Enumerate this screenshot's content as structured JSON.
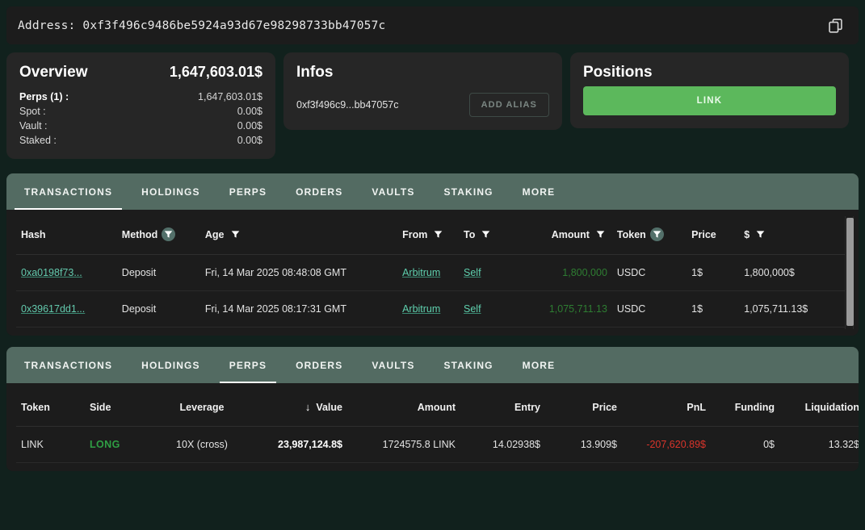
{
  "address_bar": {
    "label": "Address:",
    "value": "0xf3f496c9486be5924a93d67e98298733bb47057c",
    "copy_icon": "copy-icon"
  },
  "overview": {
    "title": "Overview",
    "total": "1,647,603.01$",
    "rows": [
      {
        "label": "Perps (1) :",
        "value": "1,647,603.01$"
      },
      {
        "label": "Spot :",
        "value": "0.00$"
      },
      {
        "label": "Vault :",
        "value": "0.00$"
      },
      {
        "label": "Staked :",
        "value": "0.00$"
      }
    ]
  },
  "infos": {
    "title": "Infos",
    "address_short": "0xf3f496c9...bb47057c",
    "add_alias_label": "ADD ALIAS"
  },
  "positions": {
    "title": "Positions",
    "link_label": "LINK"
  },
  "tabs": [
    "TRANSACTIONS",
    "HOLDINGS",
    "PERPS",
    "ORDERS",
    "VAULTS",
    "STAKING",
    "MORE"
  ],
  "transactions_panel": {
    "active_tab": "TRANSACTIONS",
    "columns": [
      {
        "label": "Hash",
        "filter": "none"
      },
      {
        "label": "Method",
        "filter": "active"
      },
      {
        "label": "Age",
        "filter": "idle"
      },
      {
        "label": "From",
        "filter": "idle"
      },
      {
        "label": "To",
        "filter": "idle"
      },
      {
        "label": "Amount",
        "filter": "idle"
      },
      {
        "label": "Token",
        "filter": "active"
      },
      {
        "label": "Price",
        "filter": "none"
      },
      {
        "label": "$",
        "filter": "idle"
      }
    ],
    "rows": [
      {
        "hash": "0xa0198f73...",
        "method": "Deposit",
        "age": "Fri, 14 Mar 2025 08:48:08 GMT",
        "from": "Arbitrum",
        "to": "Self",
        "amount": "1,800,000",
        "token": "USDC",
        "price": "1$",
        "usd": "1,800,000$"
      },
      {
        "hash": "0x39617dd1...",
        "method": "Deposit",
        "age": "Fri, 14 Mar 2025 08:17:31 GMT",
        "from": "Arbitrum",
        "to": "Self",
        "amount": "1,075,711.13",
        "token": "USDC",
        "price": "1$",
        "usd": "1,075,711.13$"
      }
    ]
  },
  "perps_panel": {
    "active_tab": "PERPS",
    "columns": [
      {
        "label": "Token"
      },
      {
        "label": "Side"
      },
      {
        "label": "Leverage"
      },
      {
        "label": "Value",
        "sort": "desc"
      },
      {
        "label": "Amount"
      },
      {
        "label": "Entry"
      },
      {
        "label": "Price"
      },
      {
        "label": "PnL"
      },
      {
        "label": "Funding"
      },
      {
        "label": "Liquidation"
      }
    ],
    "rows": [
      {
        "token": "LINK",
        "side": "LONG",
        "leverage": "10X (cross)",
        "value": "23,987,124.8$",
        "amount": "1724575.8 LINK",
        "entry": "14.02938$",
        "price": "13.909$",
        "pnl": "-207,620.89$",
        "funding": "0$",
        "liquidation": "13.32$"
      }
    ]
  },
  "colors": {
    "accent_green": "#5cb85c",
    "link_teal": "#5fd0ae",
    "positive": "#2e7d32",
    "negative": "#d9342b",
    "tabbar": "#536b62",
    "page_bg": "#11211d"
  }
}
